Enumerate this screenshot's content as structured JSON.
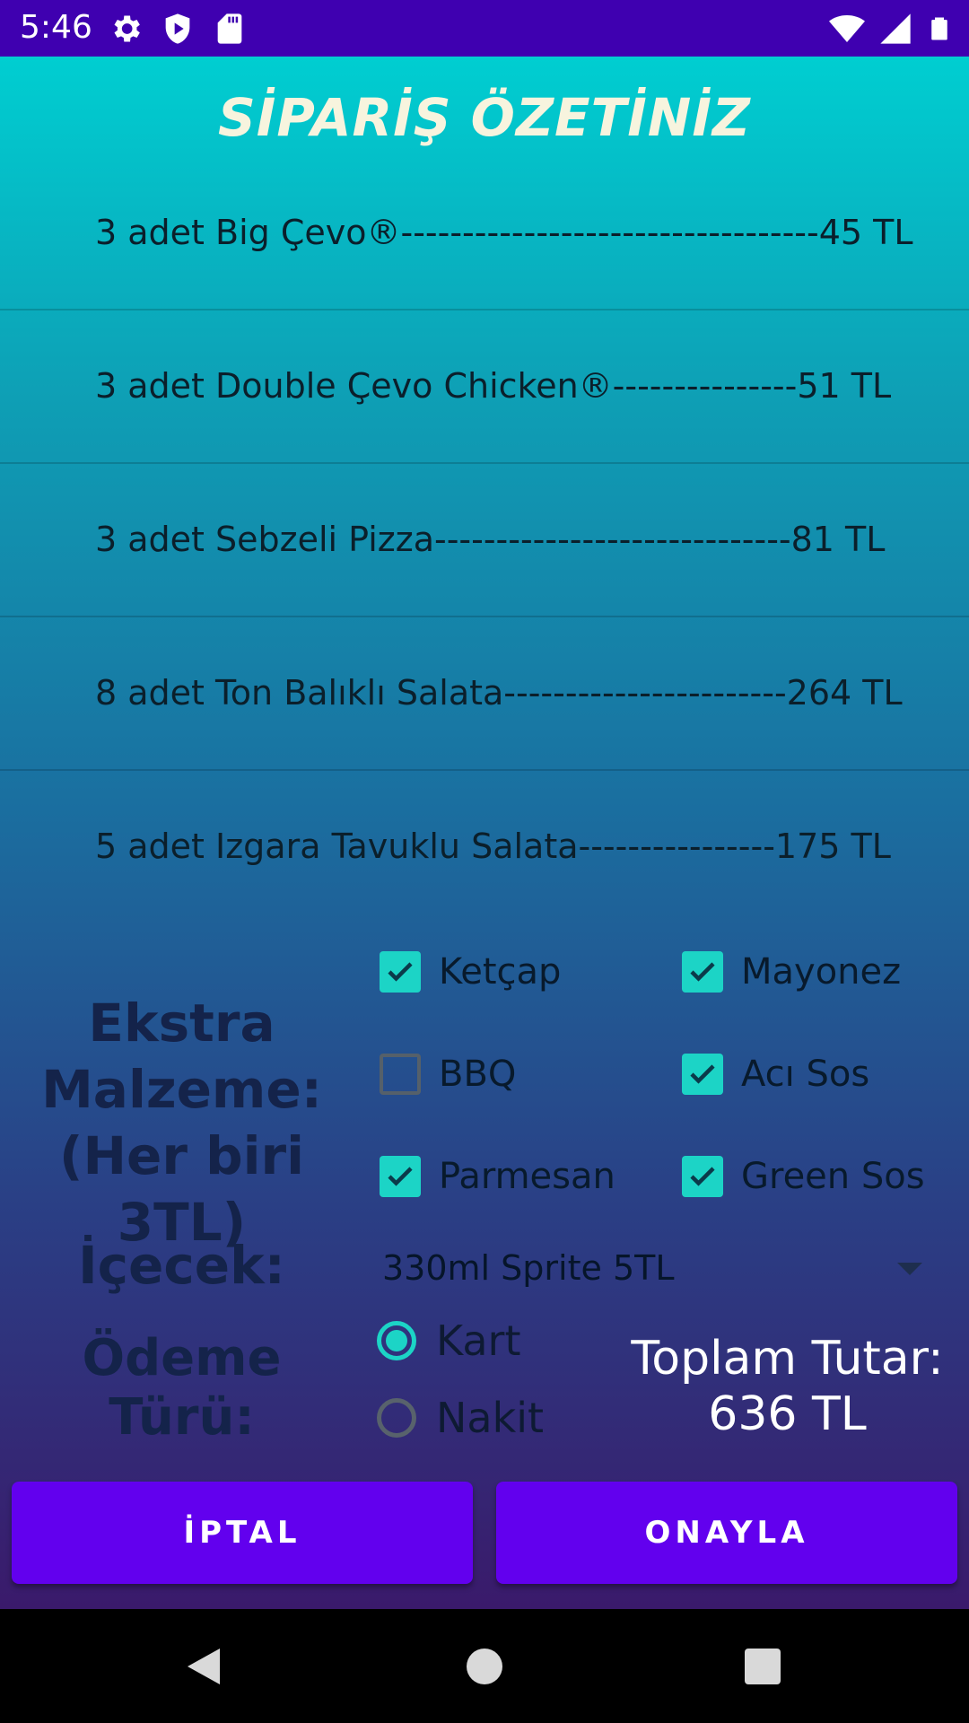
{
  "status_bar": {
    "time": "5:46",
    "left_icons": [
      "gear-icon",
      "shield-play-icon",
      "sd-card-icon"
    ],
    "right_icons": [
      "wifi-icon",
      "signal-icon",
      "battery-icon"
    ]
  },
  "title": "SİPARİŞ ÖZETİNİZ",
  "orders": [
    {
      "text": "3 adet Big Çevo®----------------------------------45 TL"
    },
    {
      "text": "3 adet Double Çevo Chicken®---------------51 TL"
    },
    {
      "text": "3 adet Sebzeli Pizza-----------------------------81 TL"
    },
    {
      "text": "8 adet Ton Balıklı Salata-----------------------264 TL"
    },
    {
      "text": "5 adet Izgara Tavuklu Salata----------------175 TL"
    }
  ],
  "extras": {
    "label_line1": "Ekstra",
    "label_line2": "Malzeme:",
    "label_line3": "(Her biri 3TL)",
    "options": [
      {
        "label": "Ketçap",
        "checked": true
      },
      {
        "label": "Mayonez",
        "checked": true
      },
      {
        "label": "BBQ",
        "checked": false
      },
      {
        "label": "Acı Sos",
        "checked": true
      },
      {
        "label": "Parmesan",
        "checked": true
      },
      {
        "label": "Green Sos",
        "checked": true
      }
    ]
  },
  "drink": {
    "label": "İçecek:",
    "selected": "330ml Sprite 5TL"
  },
  "payment": {
    "label_line1": "Ödeme",
    "label_line2": "Türü:",
    "options": [
      {
        "label": "Kart",
        "selected": true
      },
      {
        "label": "Nakit",
        "selected": false
      }
    ]
  },
  "total": {
    "label": "Toplam Tutar:",
    "value": "636 TL"
  },
  "buttons": {
    "cancel": "İPTAL",
    "confirm": "ONAYLA"
  },
  "colors": {
    "status_bar": "#3f00b0",
    "accent": "#1cd4c6",
    "button": "#6200ee"
  }
}
